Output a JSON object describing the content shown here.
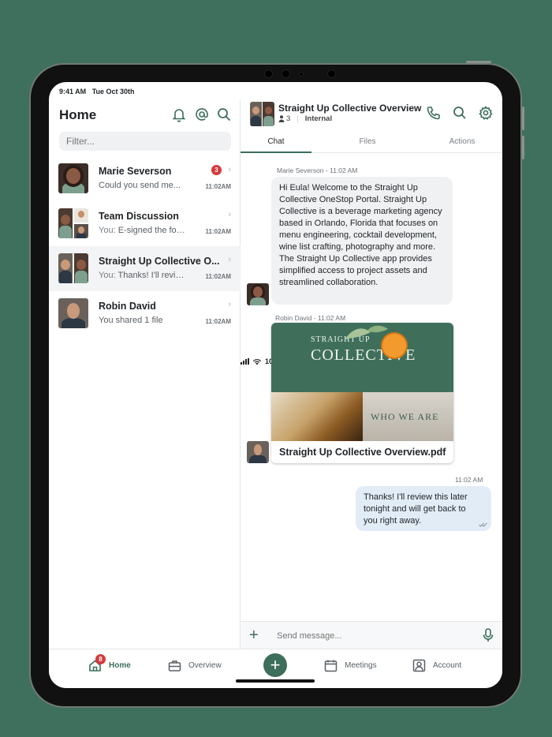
{
  "status_bar": {
    "time": "9:41 AM",
    "date": "Tue Oct 30th",
    "battery": "100%"
  },
  "sidebar": {
    "title": "Home",
    "filter_placeholder": "Filter...",
    "conversations": [
      {
        "name": "Marie Severson",
        "preview": "Could you send me...",
        "time": "11:02AM",
        "unread": "3",
        "active": false
      },
      {
        "name": "Team Discussion",
        "preview_prefix": "You: ",
        "preview": "E-signed the form...",
        "time": "11:02AM",
        "unread": "",
        "active": false
      },
      {
        "name": "Straight Up Collective O...",
        "preview_prefix": "You: ",
        "preview": "Thanks! I'll review...",
        "time": "11:02AM",
        "unread": "",
        "active": true
      },
      {
        "name": "Robin David",
        "preview": "You shared 1 file",
        "time": "11:02AM",
        "unread": "",
        "active": false
      }
    ]
  },
  "channel": {
    "title": "Straight Up Collective Overview",
    "member_count": "3",
    "visibility": "Internal",
    "tabs": [
      {
        "label": "Chat",
        "active": true
      },
      {
        "label": "Files",
        "active": false
      },
      {
        "label": "Actions",
        "active": false
      }
    ],
    "messages": [
      {
        "sender": "Marie Severson",
        "time": "11:02 AM",
        "text": "Hi Eula! Welcome to the Straight Up Collective OneStop Portal. Straight Up Collective is a beverage marketing agency based in Orlando, Florida that focuses on menu engineering, cocktail development, wine list crafting, photography and more. The Straight Up Collective app provides simplified access to project assets and streamlined collaboration."
      },
      {
        "sender": "Robin David",
        "time": "11:02 AM",
        "attachment": {
          "name": "Straight Up Collective Overview.pdf",
          "logo_top": "STRAIGHT UP",
          "logo_bottom": "COLLECTIVE",
          "banner": "WHO WE ARE"
        }
      },
      {
        "sender": "You",
        "time": "11:02 AM",
        "text": "Thanks! I'll review this later tonight and will get back to you right away."
      }
    ],
    "composer_placeholder": "Send message..."
  },
  "nav": {
    "items": [
      {
        "label": "Home",
        "badge": "8",
        "active": true
      },
      {
        "label": "Overview",
        "active": false
      },
      {
        "label": "Meetings",
        "active": false
      },
      {
        "label": "Account",
        "active": false
      }
    ],
    "fab_label": "+"
  },
  "colors": {
    "brand": "#3c6e5a",
    "badge": "#d6393d",
    "outgoing_bubble": "#e2ecf7",
    "incoming_bubble": "#eff1f3",
    "background": "#3f6f5d"
  },
  "icons": [
    "bell-icon",
    "at-icon",
    "search-icon",
    "phone-icon",
    "gear-icon",
    "person-icon",
    "chevron-right-icon",
    "plus-icon",
    "microphone-icon",
    "home-icon",
    "briefcase-icon",
    "calendar-icon",
    "account-icon",
    "read-receipt-icon"
  ]
}
